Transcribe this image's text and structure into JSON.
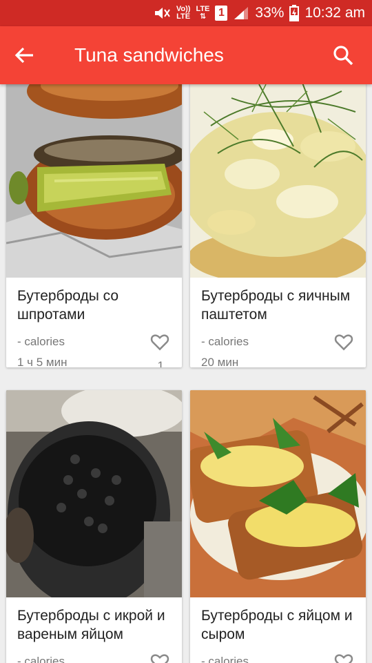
{
  "statusbar": {
    "volte_top": "Vo))",
    "volte_bottom": "LTE",
    "lte_label": "LTE",
    "sim_slot": "1",
    "battery": "33%",
    "time": "10:32 am",
    "icons": [
      "mute-icon",
      "signal-icon",
      "battery-icon"
    ]
  },
  "appbar": {
    "title": "Tuna sandwiches",
    "back_icon": "arrow-back-icon",
    "search_icon": "search-icon",
    "color": "#f44336",
    "status_color": "#cf2a25"
  },
  "recipes": [
    {
      "name": "Бутерброды со шпротами",
      "calories": "- calories",
      "time": "1 ч 5 мин",
      "likes": "1"
    },
    {
      "name": "Бутерброды с яичным паштетом",
      "calories": "- calories",
      "time": "20 мин",
      "likes": ""
    },
    {
      "name": "Бутерброды с икрой и вареным яйцом",
      "calories": "- calories",
      "time": "",
      "likes": ""
    },
    {
      "name": "Бутерброды с яйцом и сыром",
      "calories": "- calories",
      "time": "",
      "likes": ""
    }
  ]
}
